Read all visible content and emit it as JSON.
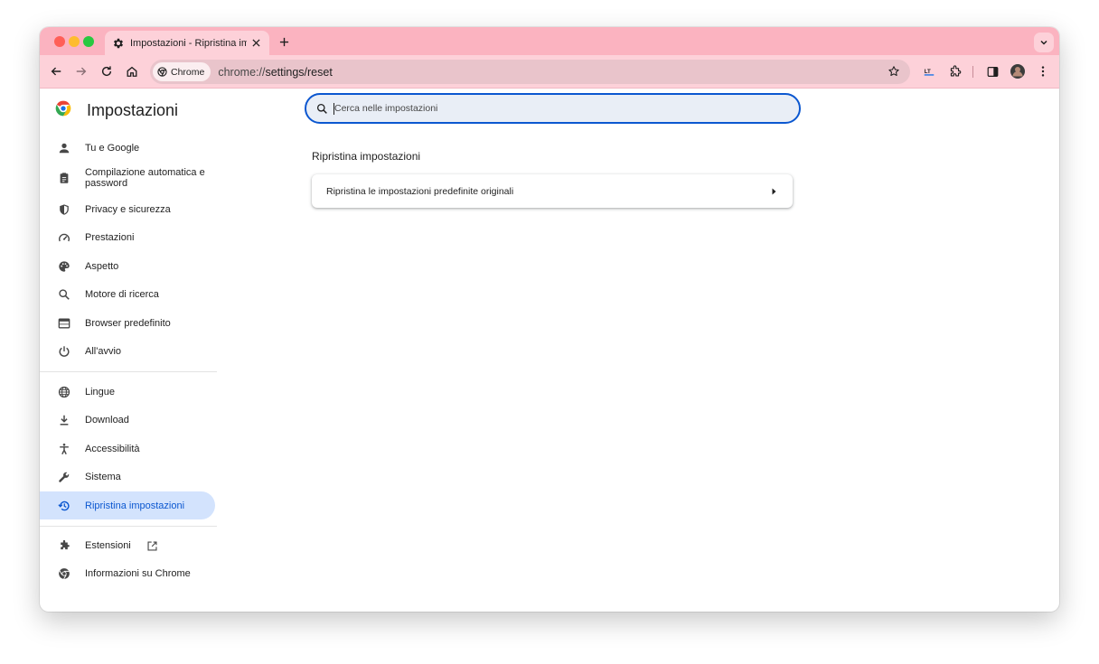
{
  "tab": {
    "title": "Impostazioni - Ripristina impo",
    "icon": "gear-icon"
  },
  "toolbar": {
    "chip_label": "Chrome",
    "url_prefix": "chrome://",
    "url_path": "settings/reset"
  },
  "sidebar": {
    "title": "Impostazioni",
    "logo": "chrome-logo",
    "items": [
      {
        "label": "Tu e Google",
        "icon": "person-icon"
      },
      {
        "label": "Compilazione automatica e password",
        "icon": "clipboard-icon"
      },
      {
        "label": "Privacy e sicurezza",
        "icon": "shield-icon"
      },
      {
        "label": "Prestazioni",
        "icon": "speedometer-icon"
      },
      {
        "label": "Aspetto",
        "icon": "palette-icon"
      },
      {
        "label": "Motore di ricerca",
        "icon": "search-icon"
      },
      {
        "label": "Browser predefinito",
        "icon": "browser-window-icon"
      },
      {
        "label": "All'avvio",
        "icon": "power-icon"
      },
      {
        "label": "Lingue",
        "icon": "globe-icon"
      },
      {
        "label": "Download",
        "icon": "download-icon"
      },
      {
        "label": "Accessibilità",
        "icon": "accessibility-icon"
      },
      {
        "label": "Sistema",
        "icon": "wrench-icon"
      },
      {
        "label": "Ripristina impostazioni",
        "icon": "restore-history-icon",
        "active": true
      },
      {
        "label": "Estensioni",
        "icon": "puzzle-icon"
      },
      {
        "label": "Informazioni su Chrome",
        "icon": "chrome-icon"
      }
    ]
  },
  "search": {
    "placeholder": "Cerca nelle impostazioni"
  },
  "main": {
    "section_title": "Ripristina impostazioni",
    "row_label": "Ripristina le impostazioni predefinite originali"
  },
  "colors": {
    "frame": "#fbb3c0",
    "toolbar": "#fdd1d9",
    "accent": "#0b57d0",
    "active_nav_bg": "#d3e3fd"
  }
}
